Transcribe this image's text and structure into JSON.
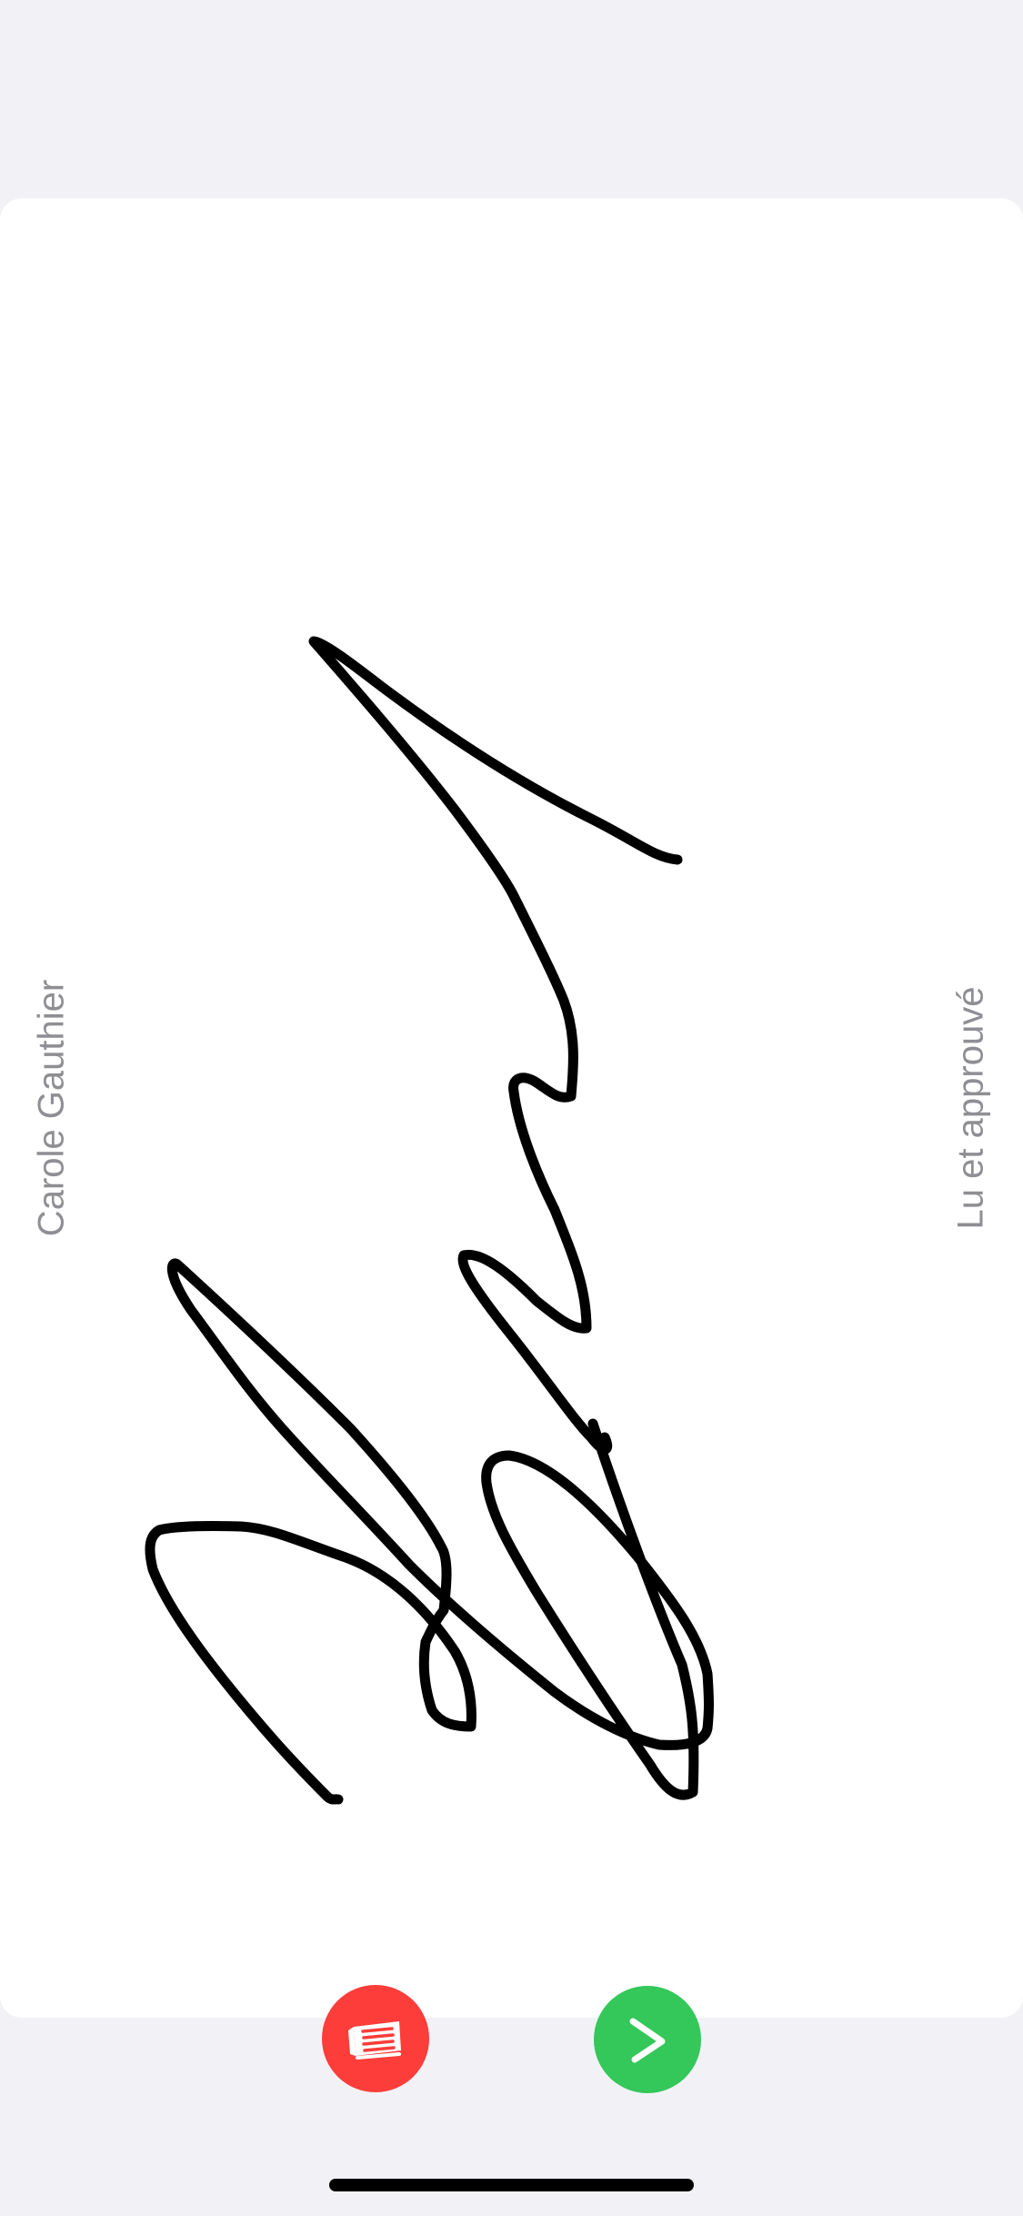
{
  "signer": {
    "name": "Carole Gauthier"
  },
  "mention": {
    "text": "Lu et approuvé"
  },
  "actions": {
    "clear_icon": "eraser-icon",
    "next_icon": "chevron-right-icon"
  },
  "colors": {
    "background": "#f2f2f6",
    "card": "#ffffff",
    "label": "#8e8e93",
    "clear_button": "#fc3d39",
    "next_button": "#34c759",
    "ink": "#000000"
  }
}
